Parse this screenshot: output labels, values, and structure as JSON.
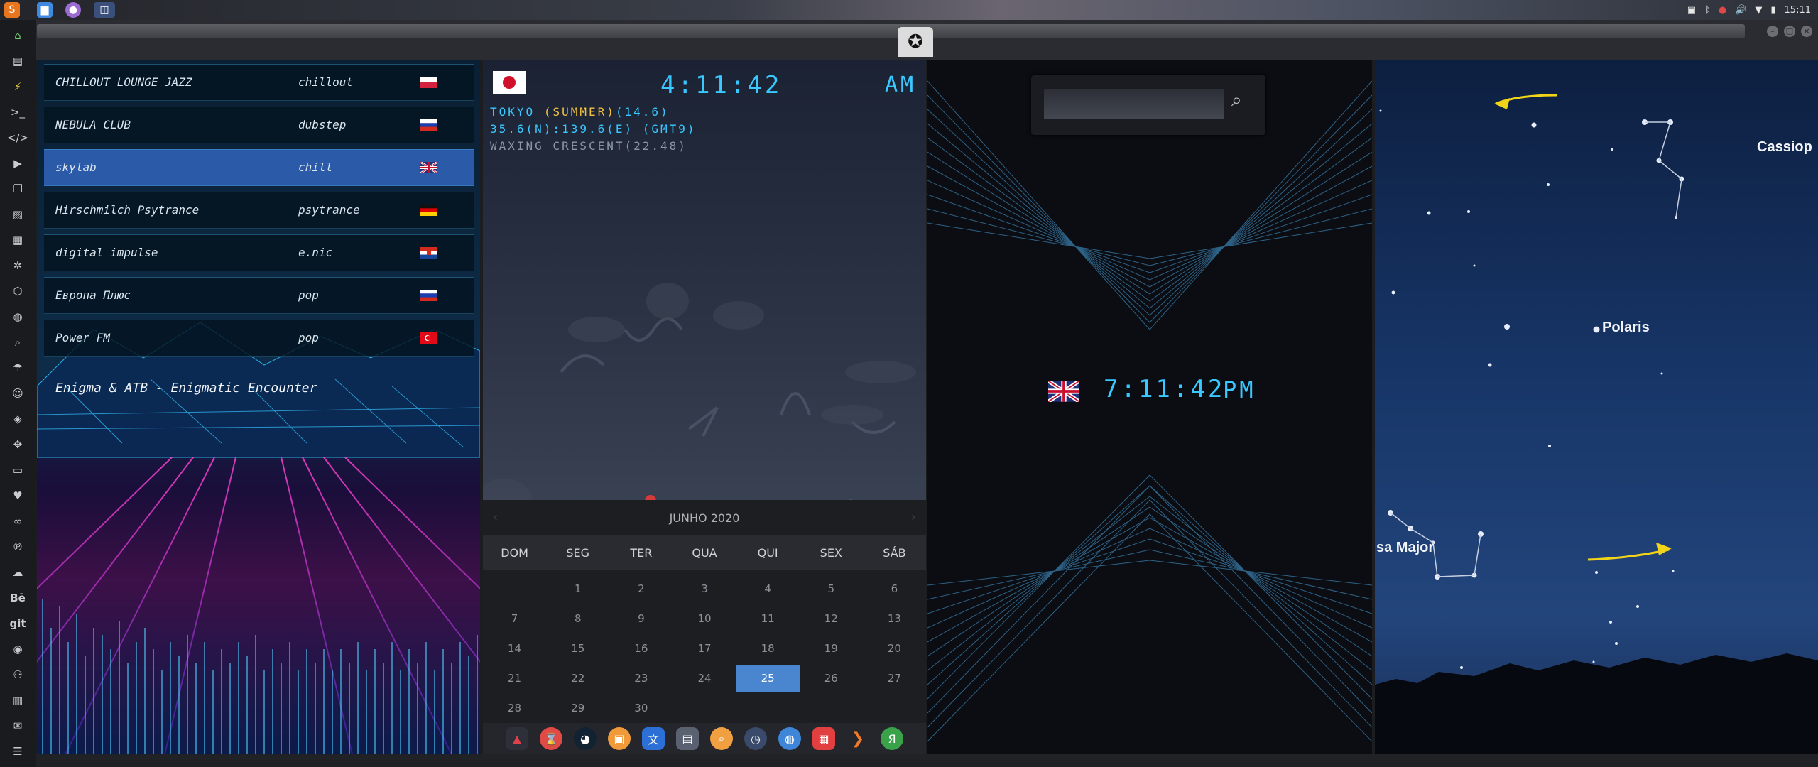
{
  "system": {
    "clock": "15:11"
  },
  "radio": {
    "stations": [
      {
        "name": "CHILLOUT LOUNGE JAZZ",
        "genre": "chillout",
        "flag": "poland"
      },
      {
        "name": "NEBULA CLUB",
        "genre": "dubstep",
        "flag": "russia"
      },
      {
        "name": "skylab",
        "genre": "chill",
        "flag": "uk"
      },
      {
        "name": "Hirschmilch Psytrance",
        "genre": "psytrance",
        "flag": "germany"
      },
      {
        "name": "digital impulse",
        "genre": "e.nic",
        "flag": "croatia"
      },
      {
        "name": "Европа Плюс",
        "genre": "pop",
        "flag": "russia"
      },
      {
        "name": "Power FM",
        "genre": "pop",
        "flag": "turkey"
      }
    ],
    "now_playing": "Enigma & ATB - Enigmatic Encounter"
  },
  "astro": {
    "time": "4:11:42",
    "ampm": "AM",
    "line1_city": "TOKYO",
    "line1_season": "(SUMMER)",
    "line1_temp": "(14.6)",
    "line2": "35.6(N):139.6(E) (GMT9)",
    "line3": "WAXING CRESCENT(22.48)"
  },
  "calendar": {
    "month": "JUNHO 2020",
    "days_of_week": [
      "DOM",
      "SEG",
      "TER",
      "QUA",
      "QUI",
      "SEX",
      "SÁB"
    ],
    "days": [
      "",
      "1",
      "2",
      "3",
      "4",
      "5",
      "6",
      "7",
      "8",
      "9",
      "10",
      "11",
      "12",
      "13",
      "14",
      "15",
      "16",
      "17",
      "18",
      "19",
      "20",
      "21",
      "22",
      "23",
      "24",
      "25",
      "26",
      "27",
      "28",
      "29",
      "30",
      "",
      "",
      "",
      ""
    ],
    "today": "25"
  },
  "world_clock": {
    "time": "7:11:42",
    "ampm": "PM"
  },
  "sky": {
    "labels": {
      "cassiopeia": "Cassiop",
      "polaris": "Polaris",
      "ursa_major": "sa Major"
    }
  },
  "colors": {
    "lcd": "#39c8ff",
    "selected_station": "#2b5aa8",
    "calendar_today": "#4a86cf"
  }
}
